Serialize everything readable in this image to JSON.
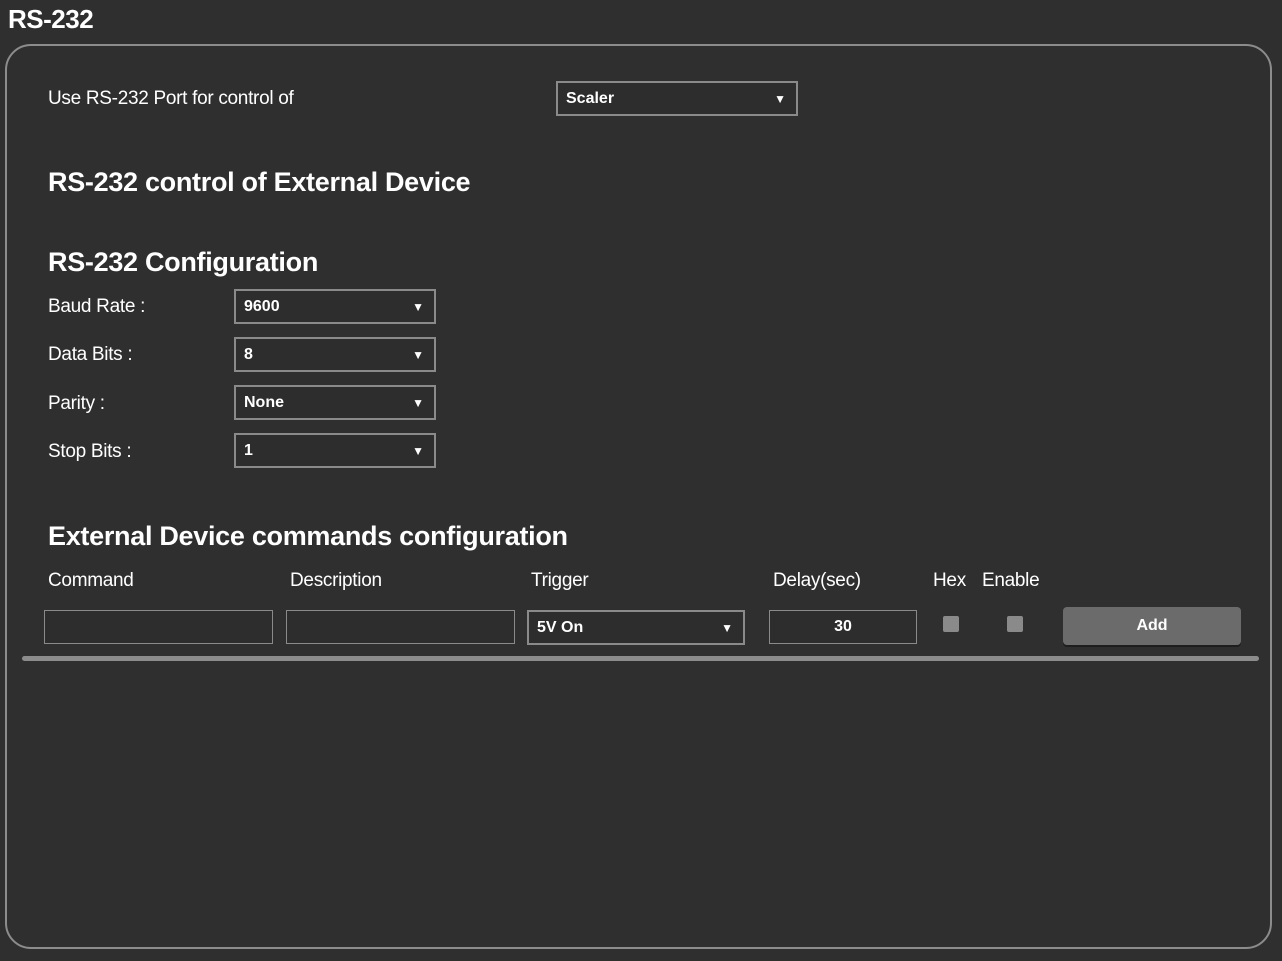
{
  "page": {
    "title": "RS-232"
  },
  "port_control": {
    "label": "Use RS-232 Port for control of",
    "selected": "Scaler"
  },
  "external_device": {
    "heading": "RS-232 control of External Device"
  },
  "configuration": {
    "heading": "RS-232 Configuration",
    "baud_rate": {
      "label": "Baud Rate :",
      "value": "9600"
    },
    "data_bits": {
      "label": "Data Bits :",
      "value": "8"
    },
    "parity": {
      "label": "Parity :",
      "value": "None"
    },
    "stop_bits": {
      "label": "Stop Bits :",
      "value": "1"
    }
  },
  "commands": {
    "heading": "External Device commands configuration",
    "columns": {
      "command": "Command",
      "description": "Description",
      "trigger": "Trigger",
      "delay": "Delay(sec)",
      "hex": "Hex",
      "enable": "Enable"
    },
    "new_row": {
      "command": "",
      "description": "",
      "trigger": "5V On",
      "delay": "30",
      "hex": false,
      "enable": false
    },
    "add_label": "Add"
  },
  "icons": {
    "dropdown_arrow": "▼"
  },
  "colors": {
    "background": "#2f2f2f",
    "border": "#8c8c8c",
    "button": "#6b6b6b",
    "text": "#ffffff"
  }
}
